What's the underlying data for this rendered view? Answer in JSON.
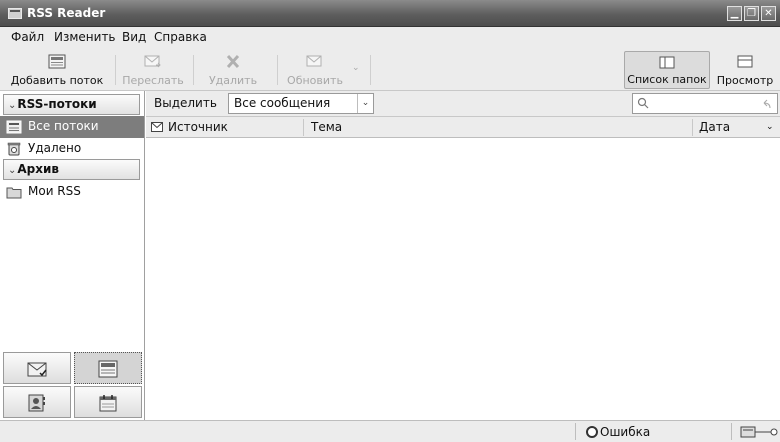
{
  "window": {
    "title": "RSS Reader"
  },
  "menu": [
    "Файл",
    "Изменить",
    "Вид",
    "Справка"
  ],
  "toolbar": {
    "add_feed": "Добавить поток",
    "forward": "Переслать",
    "delete": "Удалить",
    "refresh": "Обновить",
    "folder_list": "Список папок",
    "view": "Просмотр"
  },
  "sidebar": {
    "rss_group": "RSS-потоки",
    "all_feeds": "Все потоки",
    "deleted": "Удалено",
    "archive_group": "Архив",
    "my_rss": "Мои RSS"
  },
  "filter": {
    "label": "Выделить",
    "selected": "Все сообщения"
  },
  "columns": {
    "source": "Источник",
    "subject": "Тема",
    "date": "Дата"
  },
  "status": {
    "text": "Ошибка"
  }
}
